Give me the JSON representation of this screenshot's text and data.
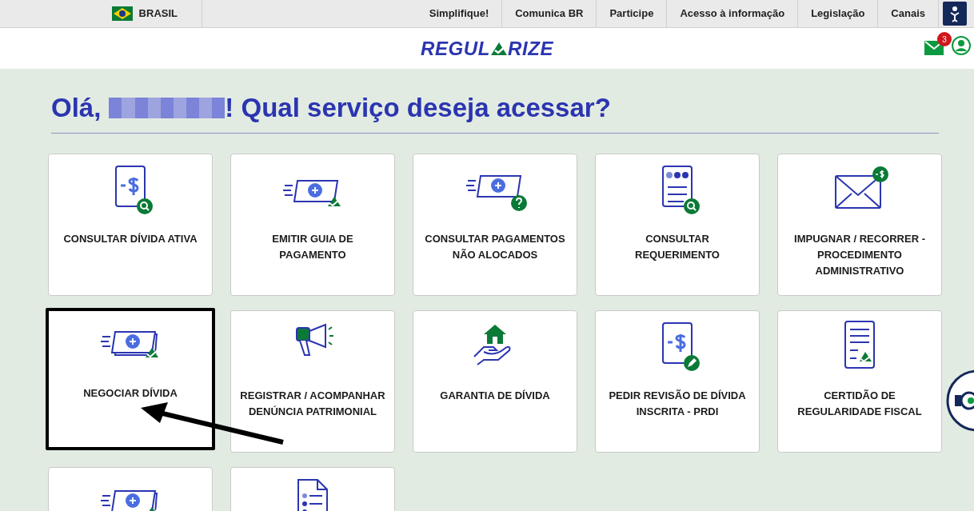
{
  "top_bar": {
    "country": "BRASIL",
    "links": [
      "Simplifique!",
      "Comunica BR",
      "Participe",
      "Acesso à informação",
      "Legislação",
      "Canais"
    ]
  },
  "header": {
    "logo_left": "REGUL",
    "logo_right": "RIZE",
    "notification_count": "3"
  },
  "greeting": {
    "prefix": "Olá,",
    "suffix": "! Qual serviço deseja acessar?"
  },
  "cards": [
    {
      "kind": "doc-minus-search",
      "label": "CONSULTAR DÍVIDA ATIVA",
      "highlighted": false
    },
    {
      "kind": "money-check",
      "label": "EMITIR GUIA DE PAGAMENTO",
      "highlighted": false
    },
    {
      "kind": "money-question",
      "label": "CONSULTAR PAGAMENTOS NÃO ALOCADOS",
      "highlighted": false
    },
    {
      "kind": "doc-dots-search",
      "label": "CONSULTAR REQUERIMENTO",
      "highlighted": false
    },
    {
      "kind": "envelope-dollar",
      "label": "IMPUGNAR / RECORRER - PROCEDIMENTO ADMINISTRATIVO",
      "highlighted": false
    },
    {
      "kind": "stack-check",
      "label": "NEGOCIAR DÍVIDA",
      "highlighted": true
    },
    {
      "kind": "megaphone",
      "label": "REGISTRAR / ACOMPANHAR DENÚNCIA PATRIMONIAL",
      "highlighted": false
    },
    {
      "kind": "house-hand",
      "label": "GARANTIA DE DÍVIDA",
      "highlighted": false
    },
    {
      "kind": "doc-minus-pencil",
      "label": "PEDIR REVISÃO DE DÍVIDA INSCRITA - PRDI",
      "highlighted": false
    },
    {
      "kind": "certificate",
      "label": "CERTIDÃO DE REGULARIDADE FISCAL",
      "highlighted": false
    },
    {
      "kind": "stack-check",
      "highlighted": false
    },
    {
      "kind": "doc-list-plus",
      "highlighted": false
    }
  ]
}
